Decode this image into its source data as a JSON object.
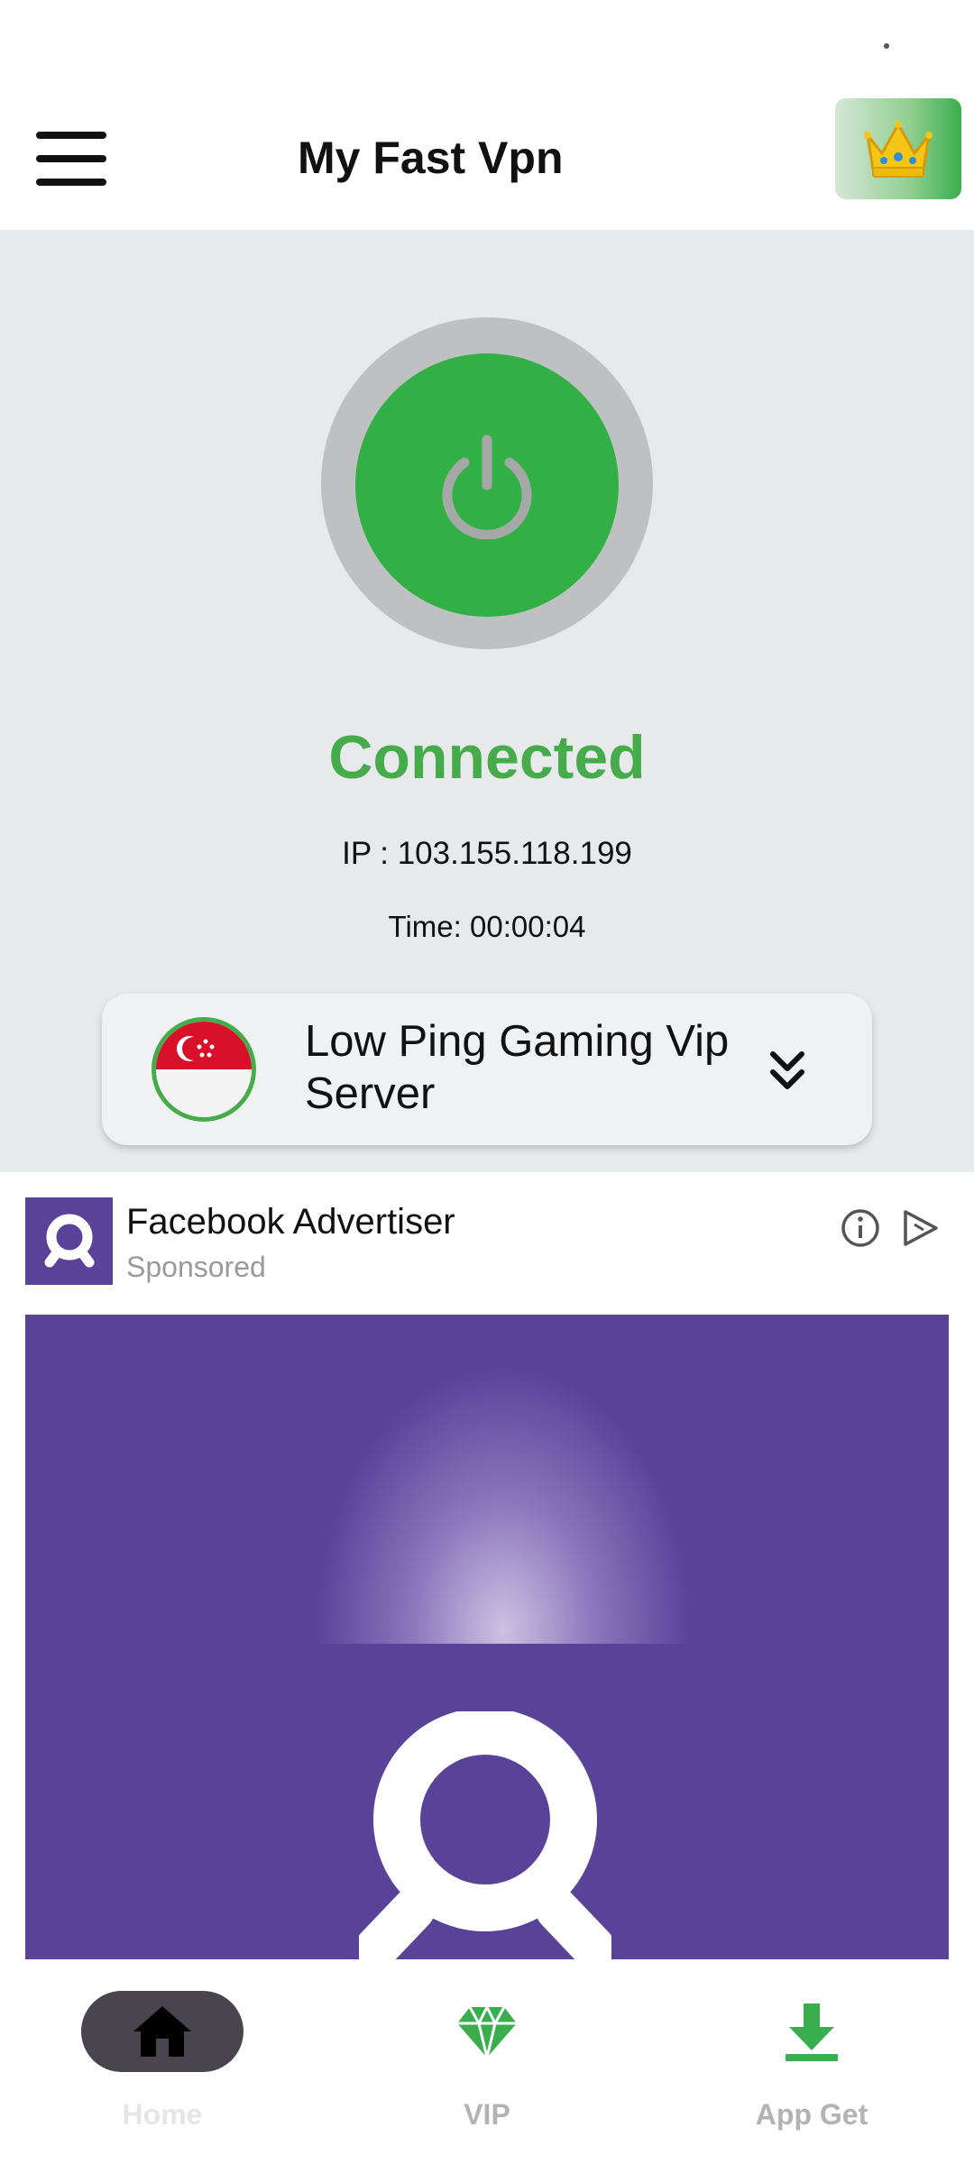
{
  "app": {
    "title": "My Fast Vpn",
    "menu_icon": "hamburger-menu-icon",
    "premium_icon": "crown-icon"
  },
  "connection": {
    "status": "Connected",
    "ip": "IP : 103.155.118.199",
    "time": "Time: 00:00:04",
    "power_icon": "power-icon"
  },
  "server": {
    "name": "Low Ping Gaming Vip Server",
    "country_flag": "singapore-flag-icon",
    "dropdown_icon": "double-chevron-down-icon"
  },
  "ad": {
    "advertiser": "Facebook Advertiser",
    "sponsored_label": "Sponsored",
    "info_icon": "info-icon",
    "adchoices_icon": "adchoices-icon"
  },
  "bottom_nav": {
    "items": [
      {
        "label": "Home",
        "icon": "home-icon",
        "selected": true
      },
      {
        "label": "VIP",
        "icon": "diamond-icon",
        "selected": false
      },
      {
        "label": "App Get",
        "icon": "download-icon",
        "selected": false
      }
    ]
  },
  "colors": {
    "accent_green": "#32b045",
    "status_green": "#46ac4b",
    "hero_background": "#e8e9eb",
    "ad_purple": "#5b4299",
    "nav_selected_pill": "#48454f",
    "nav_label_inactive": "#b3b3b3",
    "nav_label_selected": "#e6e6e6"
  }
}
